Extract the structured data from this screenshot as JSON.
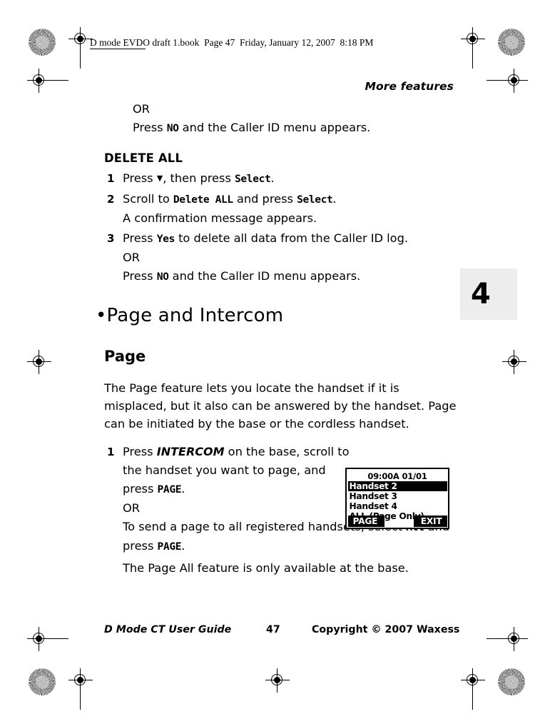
{
  "slug": "D mode EVDO draft 1.book  Page 47  Friday, January 12, 2007  8:18 PM",
  "running_head": "More features",
  "chapter_tab": "4",
  "body": {
    "or_1": "OR",
    "press_no_1_pre": "Press ",
    "press_no_1_ui": "NO",
    "press_no_1_post": " and the Caller ID menu appears.",
    "delete_all_head": "DELETE ALL",
    "step1_num": "1",
    "step1_pre": "Press ",
    "step1_arrow": "▼",
    "step1_mid": ", then press ",
    "step1_ui": "Select",
    "step1_post": ".",
    "step2_num": "2",
    "step2_pre": "Scroll to ",
    "step2_ui1": "Delete ALL",
    "step2_mid": " and press ",
    "step2_ui2": "Select",
    "step2_post": ".",
    "step2_note": "A confirmation message appears.",
    "step3_num": "3",
    "step3_pre": "Press ",
    "step3_ui": "Yes",
    "step3_post": " to delete all data from the Caller ID log.",
    "or_2": "OR",
    "press_no_2_pre": "Press ",
    "press_no_2_ui": "NO",
    "press_no_2_post": " and the Caller ID menu appears.",
    "h1": "•Page and Intercom",
    "h2": "Page",
    "page_intro": "The Page feature lets you locate the handset if it is misplaced, but it also can be answered by the handset. Page can be initiated by the base or the cordless handset.",
    "pstep1_num": "1",
    "pstep1_pre": "Press ",
    "pstep1_key": "INTERCOM",
    "pstep1_mid": " on the base, scroll to the handset you want to page, and press ",
    "pstep1_ui": "PAGE",
    "pstep1_post": ".",
    "or_3": "OR",
    "pstep1_alt_pre": "To send a page to all registered handsets, select ",
    "pstep1_alt_ui1": "All",
    "pstep1_alt_mid": " and press ",
    "pstep1_alt_ui2": "PAGE",
    "pstep1_alt_post": ".",
    "page_all_note": "The Page All feature is only available at the base."
  },
  "lcd": {
    "time": "09:00A 01/01",
    "rows": [
      {
        "label": "Handset 2",
        "selected": true
      },
      {
        "label": "Handset 3",
        "selected": false
      },
      {
        "label": "Handset 4",
        "selected": false
      },
      {
        "label": "ALL (Page Only)",
        "selected": false
      }
    ],
    "softkey_left": "PAGE",
    "softkey_right": "EXIT"
  },
  "footer": {
    "guide": "D Mode CT User Guide",
    "page_number": "47",
    "copyright": "Copyright © 2007 Waxess"
  },
  "colors": {
    "tab_bg": "#ededed",
    "ink": "#000000",
    "paper": "#ffffff"
  }
}
